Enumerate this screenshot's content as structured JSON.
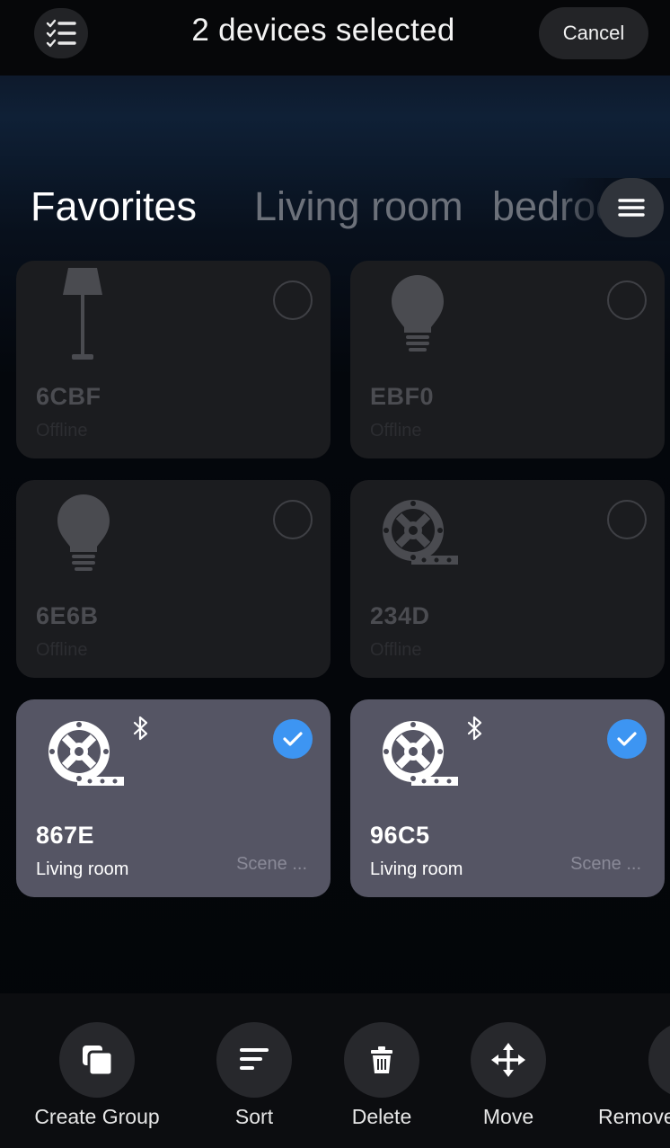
{
  "header": {
    "title": "2 devices selected",
    "cancel_label": "Cancel",
    "select_icon": "checklist-icon"
  },
  "tabs": [
    {
      "label": "Favorites",
      "active": true
    },
    {
      "label": "Living room",
      "active": false
    },
    {
      "label": "bedroom",
      "active": false
    }
  ],
  "menu_icon": "hamburger-menu-icon",
  "devices": [
    {
      "name": "6CBF",
      "status": "Offline",
      "icon": "floor-lamp-icon",
      "selected": false
    },
    {
      "name": "EBF0",
      "status": "Offline",
      "icon": "bulb-icon",
      "selected": false
    },
    {
      "name": "6E6B",
      "status": "Offline",
      "icon": "bulb-icon",
      "selected": false
    },
    {
      "name": "234D",
      "status": "Offline",
      "icon": "led-strip-icon",
      "selected": false
    },
    {
      "name": "867E",
      "status": "Living room",
      "scene": "Scene ...",
      "icon": "led-strip-icon",
      "bluetooth": true,
      "selected": true
    },
    {
      "name": "96C5",
      "status": "Living room",
      "scene": "Scene ...",
      "icon": "led-strip-icon",
      "bluetooth": true,
      "selected": true
    }
  ],
  "actions": [
    {
      "label": "Create Group",
      "icon": "create-group-icon"
    },
    {
      "label": "Sort",
      "icon": "sort-icon"
    },
    {
      "label": "Delete",
      "icon": "trash-icon"
    },
    {
      "label": "Move",
      "icon": "move-icon"
    },
    {
      "label": "Remove",
      "icon": "remove-icon"
    }
  ],
  "colors": {
    "accent": "#3d95f2",
    "selected_card": "#555564",
    "offline_card": "#1b1c1f"
  }
}
